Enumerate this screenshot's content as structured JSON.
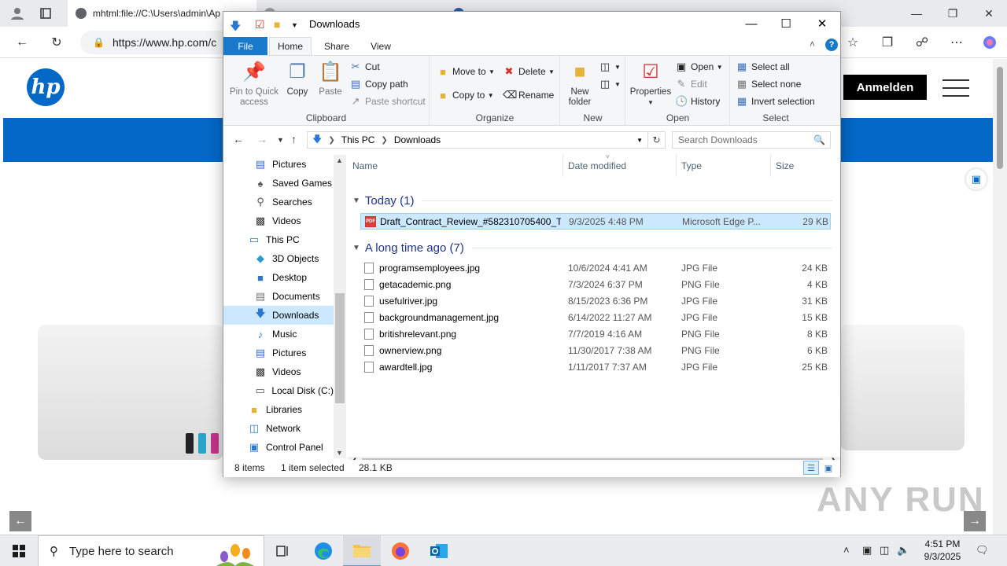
{
  "browser": {
    "tabs": [
      {
        "label": "",
        "active": false
      },
      {
        "label": "mhtml:file://C:\\Users\\admin\\Ap",
        "active": true
      },
      {
        "label": "",
        "active": false
      },
      {
        "label": "",
        "active": false
      }
    ],
    "address": "https://www.hp.com/c",
    "page": {
      "login_button": "Anmelden"
    },
    "watermark": "ANY RUN"
  },
  "explorer": {
    "title": "Downloads",
    "ribbon_tabs": [
      "File",
      "Home",
      "Share",
      "View"
    ],
    "ribbon": {
      "clipboard": {
        "label": "Clipboard",
        "pin": "Pin to Quick access",
        "pin_line1": "Pin to Quick",
        "pin_line2": "access",
        "copy": "Copy",
        "paste": "Paste",
        "cut": "Cut",
        "copy_path": "Copy path",
        "paste_shortcut": "Paste shortcut"
      },
      "organize": {
        "label": "Organize",
        "move_to": "Move to",
        "copy_to": "Copy to",
        "delete": "Delete",
        "rename": "Rename"
      },
      "new": {
        "label": "New",
        "new_folder_line1": "New",
        "new_folder_line2": "folder"
      },
      "open": {
        "label": "Open",
        "properties": "Properties",
        "open": "Open",
        "edit": "Edit",
        "history": "History"
      },
      "select": {
        "label": "Select",
        "select_all": "Select all",
        "select_none": "Select none",
        "invert": "Invert selection"
      }
    },
    "path": [
      "This PC",
      "Downloads"
    ],
    "search_placeholder": "Search Downloads",
    "nav_items": [
      {
        "label": "Pictures",
        "icon": "pictures-icon",
        "indent": 2,
        "selected": false
      },
      {
        "label": "Saved Games",
        "icon": "saved-games-icon",
        "indent": 2,
        "selected": false
      },
      {
        "label": "Searches",
        "icon": "searches-icon",
        "indent": 2,
        "selected": false
      },
      {
        "label": "Videos",
        "icon": "videos-icon",
        "indent": 2,
        "selected": false
      },
      {
        "label": "This PC",
        "icon": "this-pc-icon",
        "indent": 1,
        "selected": false
      },
      {
        "label": "3D Objects",
        "icon": "3d-objects-icon",
        "indent": 2,
        "selected": false
      },
      {
        "label": "Desktop",
        "icon": "desktop-icon",
        "indent": 2,
        "selected": false
      },
      {
        "label": "Documents",
        "icon": "documents-icon",
        "indent": 2,
        "selected": false
      },
      {
        "label": "Downloads",
        "icon": "downloads-icon",
        "indent": 2,
        "selected": true
      },
      {
        "label": "Music",
        "icon": "music-icon",
        "indent": 2,
        "selected": false
      },
      {
        "label": "Pictures",
        "icon": "pictures-icon",
        "indent": 2,
        "selected": false
      },
      {
        "label": "Videos",
        "icon": "videos-icon",
        "indent": 2,
        "selected": false
      },
      {
        "label": "Local Disk (C:)",
        "icon": "local-disk-icon",
        "indent": 2,
        "selected": false
      },
      {
        "label": "Libraries",
        "icon": "libraries-icon",
        "indent": 1,
        "selected": false
      },
      {
        "label": "Network",
        "icon": "network-icon",
        "indent": 1,
        "selected": false
      },
      {
        "label": "Control Panel",
        "icon": "control-panel-icon",
        "indent": 1,
        "selected": false
      }
    ],
    "columns": [
      "Name",
      "Date modified",
      "Type",
      "Size"
    ],
    "groups": [
      {
        "title": "Today (1)",
        "files": [
          {
            "name": "Draft_Contract_Review_#582310705400_T...",
            "date": "9/3/2025 4:48 PM",
            "type": "Microsoft Edge P...",
            "size": "29 KB",
            "icon": "pdf-file-icon",
            "selected": true
          }
        ]
      },
      {
        "title": "A long time ago (7)",
        "files": [
          {
            "name": "programsemployees.jpg",
            "date": "10/6/2024 4:41 AM",
            "type": "JPG File",
            "size": "24 KB",
            "icon": "image-file-icon",
            "selected": false
          },
          {
            "name": "getacademic.png",
            "date": "7/3/2024 6:37 PM",
            "type": "PNG File",
            "size": "4 KB",
            "icon": "image-file-icon",
            "selected": false
          },
          {
            "name": "usefulriver.jpg",
            "date": "8/15/2023 6:36 PM",
            "type": "JPG File",
            "size": "31 KB",
            "icon": "image-file-icon",
            "selected": false
          },
          {
            "name": "backgroundmanagement.jpg",
            "date": "6/14/2022 11:27 AM",
            "type": "JPG File",
            "size": "15 KB",
            "icon": "image-file-icon",
            "selected": false
          },
          {
            "name": "britishrelevant.png",
            "date": "7/7/2019 4:16 AM",
            "type": "PNG File",
            "size": "8 KB",
            "icon": "image-file-icon",
            "selected": false
          },
          {
            "name": "ownerview.png",
            "date": "11/30/2017 7:38 AM",
            "type": "PNG File",
            "size": "6 KB",
            "icon": "image-file-icon",
            "selected": false
          },
          {
            "name": "awardtell.jpg",
            "date": "1/11/2017 7:37 AM",
            "type": "JPG File",
            "size": "25 KB",
            "icon": "image-file-icon",
            "selected": false
          }
        ]
      }
    ],
    "status": {
      "items": "8 items",
      "selected": "1 item selected",
      "size": "28.1 KB"
    }
  },
  "taskbar": {
    "search_placeholder": "Type here to search",
    "time": "4:51 PM",
    "date": "9/3/2025"
  }
}
